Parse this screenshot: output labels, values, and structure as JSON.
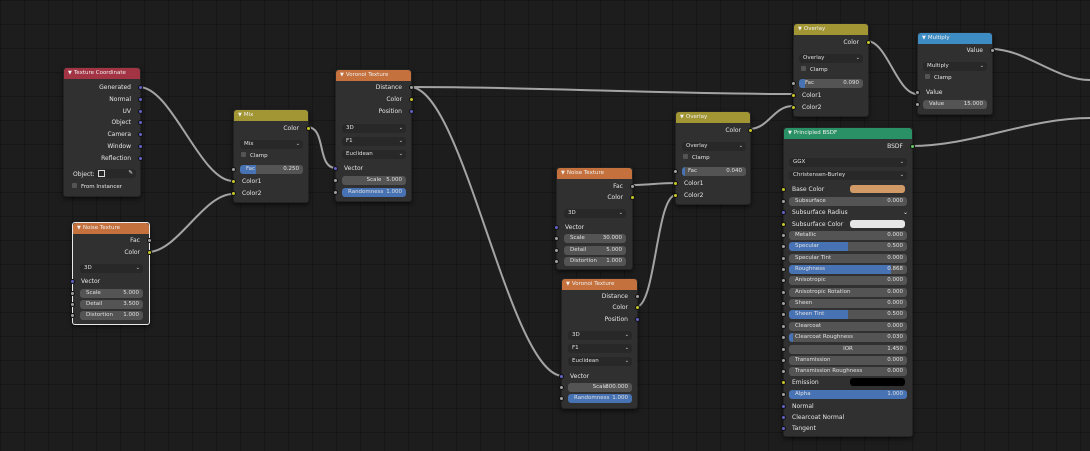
{
  "colors": {
    "header_input": "#a33444",
    "header_texture": "#c4713d",
    "header_color": "#a29534",
    "header_converter": "#3d8cc4",
    "header_shader": "#2a9065",
    "socket_color": "#c7c729",
    "socket_float": "#a1a1a1",
    "socket_vector": "#6363c7",
    "socket_shader": "#63c763",
    "wire": "#a4a4a4",
    "slider_fill": "#4772b3",
    "base_color_swatch": "#d29a67",
    "subsurface_color_swatch": "#e6e6e6",
    "emission_swatch": "#000000"
  },
  "tex_coord": {
    "title": "Texture Coordinate",
    "outputs": [
      "Generated",
      "Normal",
      "UV",
      "Object",
      "Camera",
      "Window",
      "Reflection"
    ],
    "object_label": "Object:",
    "from_instancer": "From Instancer"
  },
  "noise1": {
    "title": "Noise Texture",
    "outputs": [
      "Fac",
      "Color"
    ],
    "dimension": "3D",
    "vector_label": "Vector",
    "fields": [
      {
        "label": "Scale",
        "value": "5.000"
      },
      {
        "label": "Detail",
        "value": "3.500"
      },
      {
        "label": "Distortion",
        "value": "1.000"
      }
    ]
  },
  "mix": {
    "title": "Mix",
    "output": "Color",
    "blend": "Mix",
    "clamp": "Clamp",
    "fac_label": "Fac",
    "fac_value": "0.250",
    "fac_fill": 0.25,
    "inputs": [
      "Color1",
      "Color2"
    ]
  },
  "voronoi1": {
    "title": "Voronoi Texture",
    "outputs": [
      "Distance",
      "Color",
      "Position"
    ],
    "dims": "3D",
    "feature": "F1",
    "metric": "Euclidean",
    "vector_label": "Vector",
    "scale_label": "Scale",
    "scale_value": "5.000",
    "random_label": "Randomness",
    "random_value": "1.000",
    "random_fill": 1.0
  },
  "noise2": {
    "title": "Noise Texture",
    "outputs": [
      "Fac",
      "Color"
    ],
    "dimension": "3D",
    "vector_label": "Vector",
    "fields": [
      {
        "label": "Scale",
        "value": "30.000"
      },
      {
        "label": "Detail",
        "value": "5.000"
      },
      {
        "label": "Distortion",
        "value": "1.000"
      }
    ]
  },
  "voronoi2": {
    "title": "Voronoi Texture",
    "outputs": [
      "Distance",
      "Color",
      "Position"
    ],
    "dims": "3D",
    "feature": "F1",
    "metric": "Euclidean",
    "vector_label": "Vector",
    "scale_label": "Scale",
    "scale_value": "300.000",
    "random_label": "Randomness",
    "random_value": "1.000",
    "random_fill": 1.0
  },
  "overlay1": {
    "title": "Overlay",
    "output": "Color",
    "blend": "Overlay",
    "clamp": "Clamp",
    "fac_label": "Fac",
    "fac_value": "0.090",
    "fac_fill": 0.09,
    "inputs": [
      "Color1",
      "Color2"
    ]
  },
  "overlay2": {
    "title": "Overlay",
    "output": "Color",
    "blend": "Overlay",
    "clamp": "Clamp",
    "fac_label": "Fac",
    "fac_value": "0.040",
    "fac_fill": 0.04,
    "inputs": [
      "Color1",
      "Color2"
    ]
  },
  "multiply": {
    "title": "Multiply",
    "output": "Value",
    "operation": "Multiply",
    "clamp": "Clamp",
    "input": "Value",
    "value_label": "Value",
    "value_value": "15.000"
  },
  "bsdf": {
    "title": "Principled BSDF",
    "output": "BSDF",
    "distribution": "GGX",
    "subsurface_method": "Christensen-Burley",
    "base_color": "Base Color",
    "subsurface": {
      "label": "Subsurface",
      "value": "0.000"
    },
    "subsurface_radius": "Subsurface Radius",
    "subsurface_color": "Subsurface Color",
    "params": [
      {
        "label": "Metallic",
        "value": "0.000",
        "fill": 0
      },
      {
        "label": "Specular",
        "value": "0.500",
        "fill": 0.5
      },
      {
        "label": "Specular Tint",
        "value": "0.000",
        "fill": 0
      },
      {
        "label": "Roughness",
        "value": "0.868",
        "fill": 0.868
      },
      {
        "label": "Anisotropic",
        "value": "0.000",
        "fill": 0
      },
      {
        "label": "Anisotropic Rotation",
        "value": "0.000",
        "fill": 0
      },
      {
        "label": "Sheen",
        "value": "0.000",
        "fill": 0
      },
      {
        "label": "Sheen Tint",
        "value": "0.500",
        "fill": 0.5
      },
      {
        "label": "Clearcoat",
        "value": "0.000",
        "fill": 0
      },
      {
        "label": "Clearcoat Roughness",
        "value": "0.030",
        "fill": 0.03
      },
      {
        "label": "IOR",
        "value": "1.450",
        "fill": 0,
        "centered": true
      },
      {
        "label": "Transmission",
        "value": "0.000",
        "fill": 0
      },
      {
        "label": "Transmission Roughness",
        "value": "0.000",
        "fill": 0
      }
    ],
    "emission": "Emission",
    "alpha": {
      "label": "Alpha",
      "value": "1.000",
      "fill": 1
    },
    "normal": "Normal",
    "clearcoat_normal": "Clearcoat Normal",
    "tangent": "Tangent"
  }
}
